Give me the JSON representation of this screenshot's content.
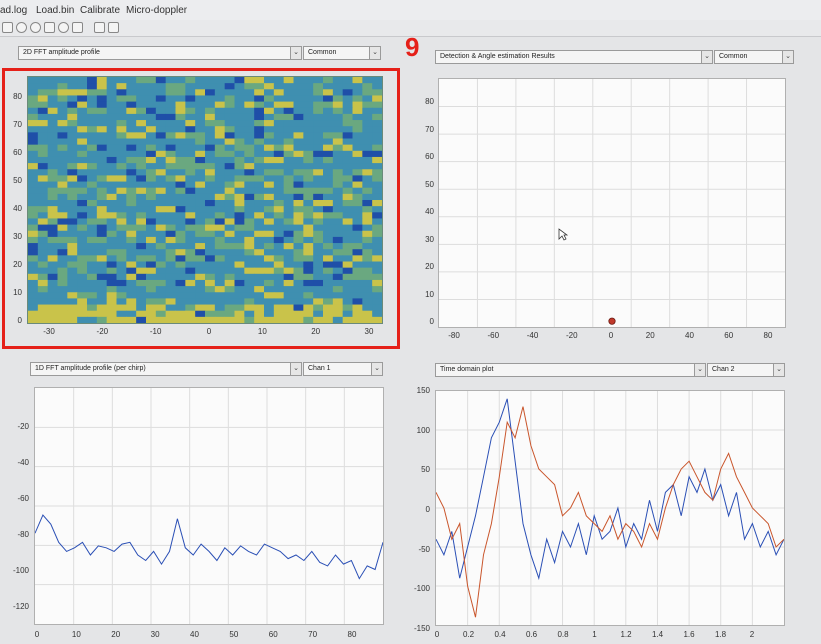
{
  "menu": {
    "items": [
      {
        "label": "ad.log"
      },
      {
        "label": "Load.bin"
      },
      {
        "label": "Calibrate"
      },
      {
        "label": "Micro-doppler"
      }
    ]
  },
  "annotation": {
    "badge": "9",
    "highlight_color": "#e52019"
  },
  "panels": {
    "top_left": {
      "select_label": "2D FFT amplitude profile",
      "mode_label": "Common",
      "y_ticks": [
        "80",
        "70",
        "60",
        "50",
        "40",
        "30",
        "20",
        "10",
        "0"
      ],
      "x_ticks": [
        "-30",
        "-20",
        "-10",
        "0",
        "10",
        "20",
        "30"
      ]
    },
    "top_right": {
      "select_label": "Detection & Angle estimation Results",
      "mode_label": "Common",
      "y_ticks": [
        "80",
        "70",
        "60",
        "50",
        "40",
        "30",
        "20",
        "10",
        "0"
      ],
      "x_ticks": [
        "-80",
        "-60",
        "-40",
        "-20",
        "0",
        "20",
        "40",
        "60",
        "80"
      ]
    },
    "bottom_left": {
      "select_label": "1D FFT amplitude profile (per chirp)",
      "mode_label": "Chan 1",
      "y_ticks": [
        "-20",
        "-40",
        "-60",
        "-80",
        "-100",
        "-120"
      ],
      "x_ticks": [
        "0",
        "10",
        "20",
        "30",
        "40",
        "50",
        "60",
        "70",
        "80"
      ]
    },
    "bottom_right": {
      "select_label": "Time domain plot",
      "mode_label": "Chan 2",
      "y_ticks": [
        "150",
        "100",
        "50",
        "0",
        "-50",
        "-100",
        "-150"
      ],
      "x_ticks": [
        "0",
        "0.2",
        "0.4",
        "0.6",
        "0.8",
        "1",
        "1.2",
        "1.4",
        "1.6",
        "1.8",
        "2"
      ]
    }
  },
  "chart_data": [
    {
      "type": "heatmap",
      "xlim": [
        -34,
        34
      ],
      "ylim": [
        0,
        88
      ],
      "colormap": [
        "#1f4fa8",
        "#3f8fb0",
        "#6aa880",
        "#c9c34a"
      ]
    },
    {
      "type": "scatter",
      "xlim": [
        -88,
        88
      ],
      "ylim": [
        0,
        88
      ],
      "series": [
        {
          "x": [
            0
          ],
          "y": [
            1
          ],
          "color": "#c0392b"
        }
      ]
    },
    {
      "type": "line",
      "xlim": [
        0,
        88
      ],
      "ylim": [
        -130,
        0
      ],
      "series": [
        {
          "color": "#2a4fb5",
          "x": [
            0,
            2,
            4,
            6,
            8,
            10,
            12,
            14,
            16,
            18,
            20,
            22,
            24,
            26,
            28,
            30,
            32,
            34,
            36,
            38,
            40,
            42,
            44,
            46,
            48,
            50,
            52,
            54,
            56,
            58,
            60,
            62,
            64,
            66,
            68,
            70,
            72,
            74,
            76,
            78,
            80,
            82,
            84,
            86,
            88
          ],
          "values": [
            -80,
            -70,
            -75,
            -85,
            -90,
            -88,
            -85,
            -92,
            -87,
            -88,
            -90,
            -86,
            -85,
            -92,
            -95,
            -90,
            -97,
            -90,
            -72,
            -88,
            -92,
            -86,
            -90,
            -95,
            -88,
            -92,
            -87,
            -90,
            -92,
            -86,
            -88,
            -90,
            -94,
            -92,
            -95,
            -90,
            -96,
            -98,
            -92,
            -97,
            -95,
            -105,
            -98,
            -100,
            -85
          ]
        }
      ]
    },
    {
      "type": "line",
      "xlim": [
        0,
        2.2
      ],
      "ylim": [
        -150,
        150
      ],
      "series": [
        {
          "color": "#2a4fb5",
          "x": [
            0,
            0.05,
            0.1,
            0.15,
            0.2,
            0.25,
            0.3,
            0.35,
            0.4,
            0.45,
            0.5,
            0.55,
            0.6,
            0.65,
            0.7,
            0.75,
            0.8,
            0.85,
            0.9,
            0.95,
            1,
            1.05,
            1.1,
            1.15,
            1.2,
            1.25,
            1.3,
            1.35,
            1.4,
            1.45,
            1.5,
            1.55,
            1.6,
            1.65,
            1.7,
            1.75,
            1.8,
            1.85,
            1.9,
            1.95,
            2,
            2.05,
            2.1,
            2.15,
            2.2
          ],
          "values": [
            -40,
            -60,
            -30,
            -90,
            -50,
            -10,
            40,
            90,
            110,
            140,
            60,
            -20,
            -60,
            -90,
            -40,
            -70,
            -30,
            -50,
            -20,
            -60,
            -10,
            -40,
            -30,
            0,
            -50,
            -20,
            -40,
            10,
            -30,
            20,
            30,
            -10,
            40,
            20,
            50,
            10,
            30,
            -10,
            20,
            -40,
            -20,
            -50,
            -30,
            -60,
            -40
          ]
        },
        {
          "color": "#c9552b",
          "x": [
            0,
            0.05,
            0.1,
            0.15,
            0.2,
            0.25,
            0.3,
            0.35,
            0.4,
            0.45,
            0.5,
            0.55,
            0.6,
            0.65,
            0.7,
            0.75,
            0.8,
            0.85,
            0.9,
            0.95,
            1,
            1.05,
            1.1,
            1.15,
            1.2,
            1.25,
            1.3,
            1.35,
            1.4,
            1.45,
            1.5,
            1.55,
            1.6,
            1.65,
            1.7,
            1.75,
            1.8,
            1.85,
            1.9,
            1.95,
            2,
            2.05,
            2.1,
            2.15,
            2.2
          ],
          "values": [
            20,
            0,
            -40,
            -20,
            -100,
            -140,
            -60,
            -20,
            40,
            110,
            90,
            130,
            80,
            50,
            40,
            30,
            -10,
            0,
            20,
            -10,
            -20,
            -30,
            -10,
            -40,
            -20,
            -30,
            -50,
            -20,
            -40,
            0,
            30,
            50,
            60,
            40,
            20,
            10,
            50,
            70,
            40,
            20,
            0,
            -10,
            -20,
            -50,
            -40
          ]
        }
      ]
    }
  ]
}
